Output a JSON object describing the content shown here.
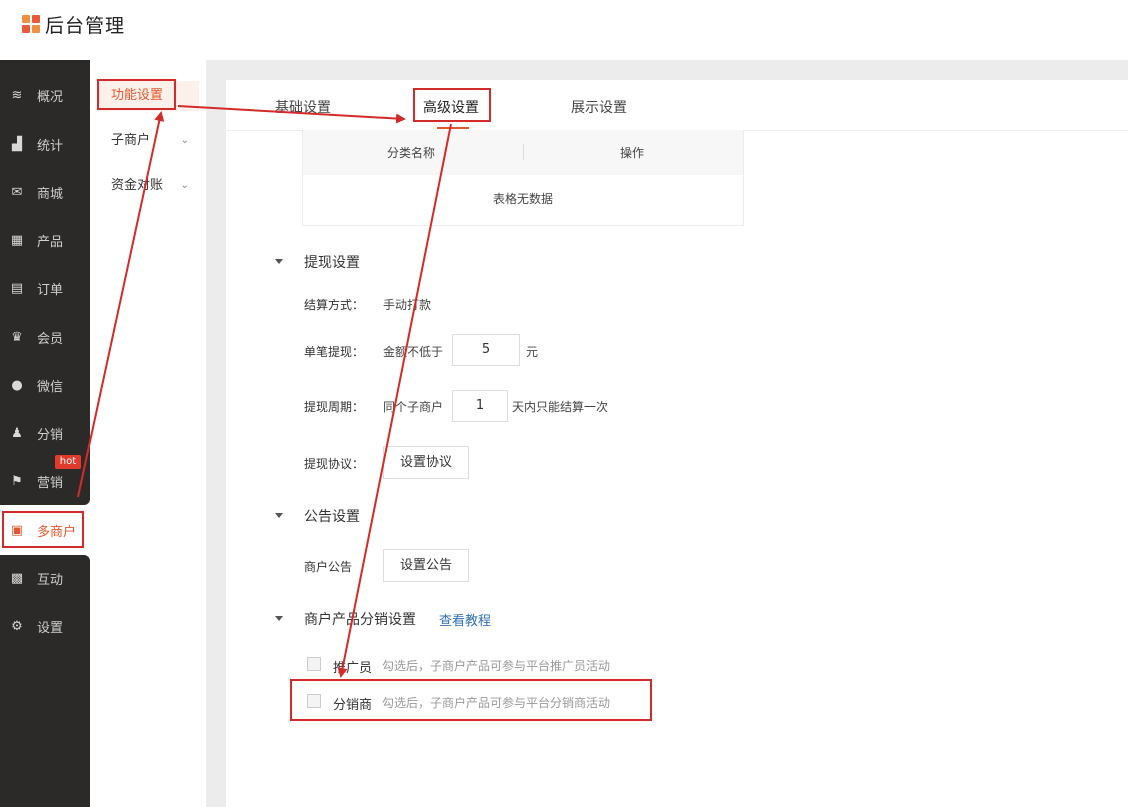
{
  "app": {
    "title": "后台管理"
  },
  "sidebar": {
    "items": [
      {
        "label": "概况",
        "icon": "layers-icon",
        "glyph": "≋"
      },
      {
        "label": "统计",
        "icon": "chart-icon",
        "glyph": "▟"
      },
      {
        "label": "商城",
        "icon": "store-icon",
        "glyph": "✉"
      },
      {
        "label": "产品",
        "icon": "grid-icon",
        "glyph": "▦"
      },
      {
        "label": "订单",
        "icon": "order-icon",
        "glyph": "▤"
      },
      {
        "label": "会员",
        "icon": "crown-icon",
        "glyph": "♛"
      },
      {
        "label": "微信",
        "icon": "wechat-icon",
        "glyph": "●"
      },
      {
        "label": "分销",
        "icon": "users-icon",
        "glyph": "♟"
      },
      {
        "label": "营销",
        "icon": "flag-icon",
        "glyph": "⚑"
      },
      {
        "label": "多商户",
        "icon": "merchant-icon",
        "glyph": "▣"
      },
      {
        "label": "互动",
        "icon": "interact-icon",
        "glyph": "▩"
      },
      {
        "label": "设置",
        "icon": "gear-icon",
        "glyph": "⚙"
      }
    ],
    "hot_badge": "hot"
  },
  "subnav": {
    "items": [
      {
        "label": "功能设置"
      },
      {
        "label": "子商户"
      },
      {
        "label": "资金对账"
      }
    ],
    "chevron": "⌄"
  },
  "tabs": [
    {
      "label": "基础设置"
    },
    {
      "label": "高级设置"
    },
    {
      "label": "展示设置"
    }
  ],
  "table": {
    "col1": "分类名称",
    "col2": "操作",
    "empty": "表格无数据"
  },
  "withdraw": {
    "title": "提现设置",
    "settle_label": "结算方式：",
    "settle_value": "手动打款",
    "single_label": "单笔提现：",
    "single_prefix": "金额不低于",
    "single_value": "5",
    "single_unit": "元",
    "period_label": "提现周期：",
    "period_prefix": "同个子商户",
    "period_value": "1",
    "period_suffix": "天内只能结算一次",
    "protocol_label": "提现协议：",
    "protocol_button": "设置协议"
  },
  "notice": {
    "title": "公告设置",
    "label": "商户公告",
    "button": "设置公告"
  },
  "distribution": {
    "title": "商户产品分销设置",
    "tutorial_link": "查看教程",
    "promoter_label": "推广员",
    "promoter_hint": "勾选后，子商户产品可参与平台推广员活动",
    "distributor_label": "分销商",
    "distributor_hint": "勾选后，子商户产品可参与平台分销商活动"
  },
  "colors": {
    "accent": "#e4572e",
    "sidebar_bg": "#2b2a28",
    "annotation": "#d42a2a",
    "link": "#2f6fb3"
  }
}
